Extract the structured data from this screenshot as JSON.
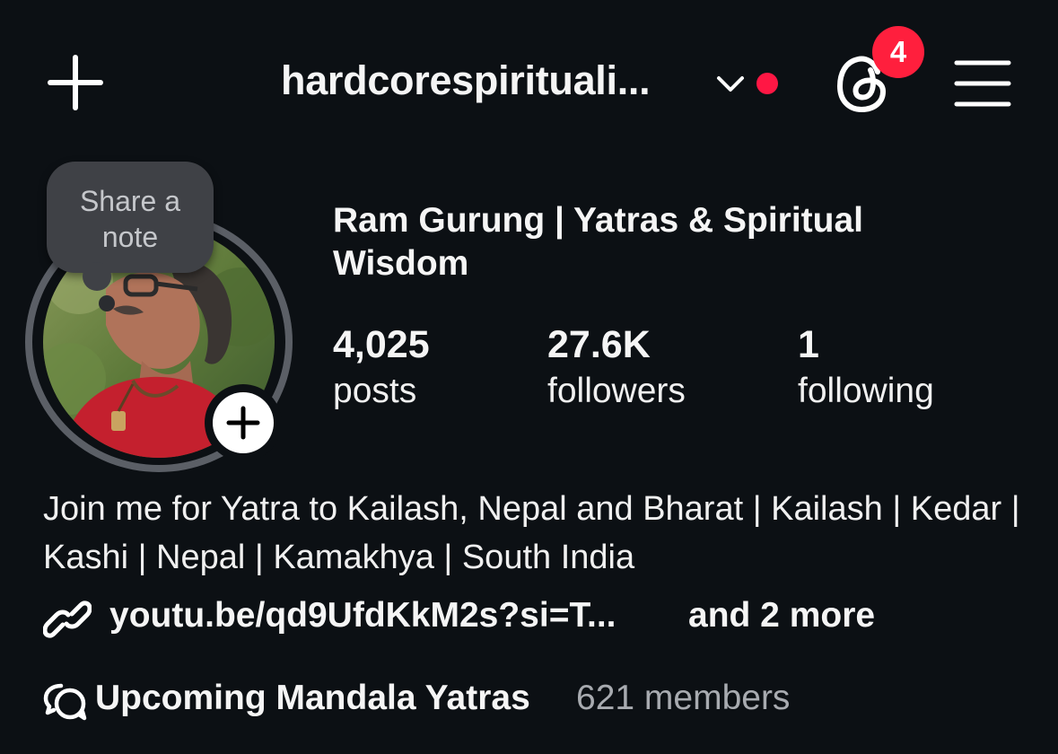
{
  "header": {
    "username": "hardcorespirituali...",
    "notification_count": "4"
  },
  "note": {
    "line1": "Share a",
    "line2": "note"
  },
  "profile": {
    "display_name": "Ram Gurung | Yatras & Spiritual Wisdom"
  },
  "stats": [
    {
      "value": "4,025",
      "label": "posts"
    },
    {
      "value": "27.6K",
      "label": "followers"
    },
    {
      "value": "1",
      "label": "following"
    }
  ],
  "bio": {
    "text": "Join me for Yatra to Kailash, Nepal and Bharat | Kailash | Kedar | Kashi | Nepal | Kamakhya | South India",
    "link": "youtu.be/qd9UfdKkM2s?si=T...",
    "link_more": "and 2 more"
  },
  "channel": {
    "name": "Upcoming Mandala Yatras",
    "members": "621 members"
  },
  "icons": {
    "create": "plus-icon",
    "account_switch": "chevron-down-icon",
    "threads": "threads-icon",
    "menu": "hamburger-menu-icon",
    "add_story": "plus-icon",
    "link": "link-icon",
    "channel": "chat-bubbles-icon"
  },
  "colors": {
    "background": "#0c1014",
    "badge": "#ff1f3d",
    "unread_dot": "#ff1744",
    "note_bubble": "#3f4146",
    "muted_text": "#a8abb0"
  }
}
